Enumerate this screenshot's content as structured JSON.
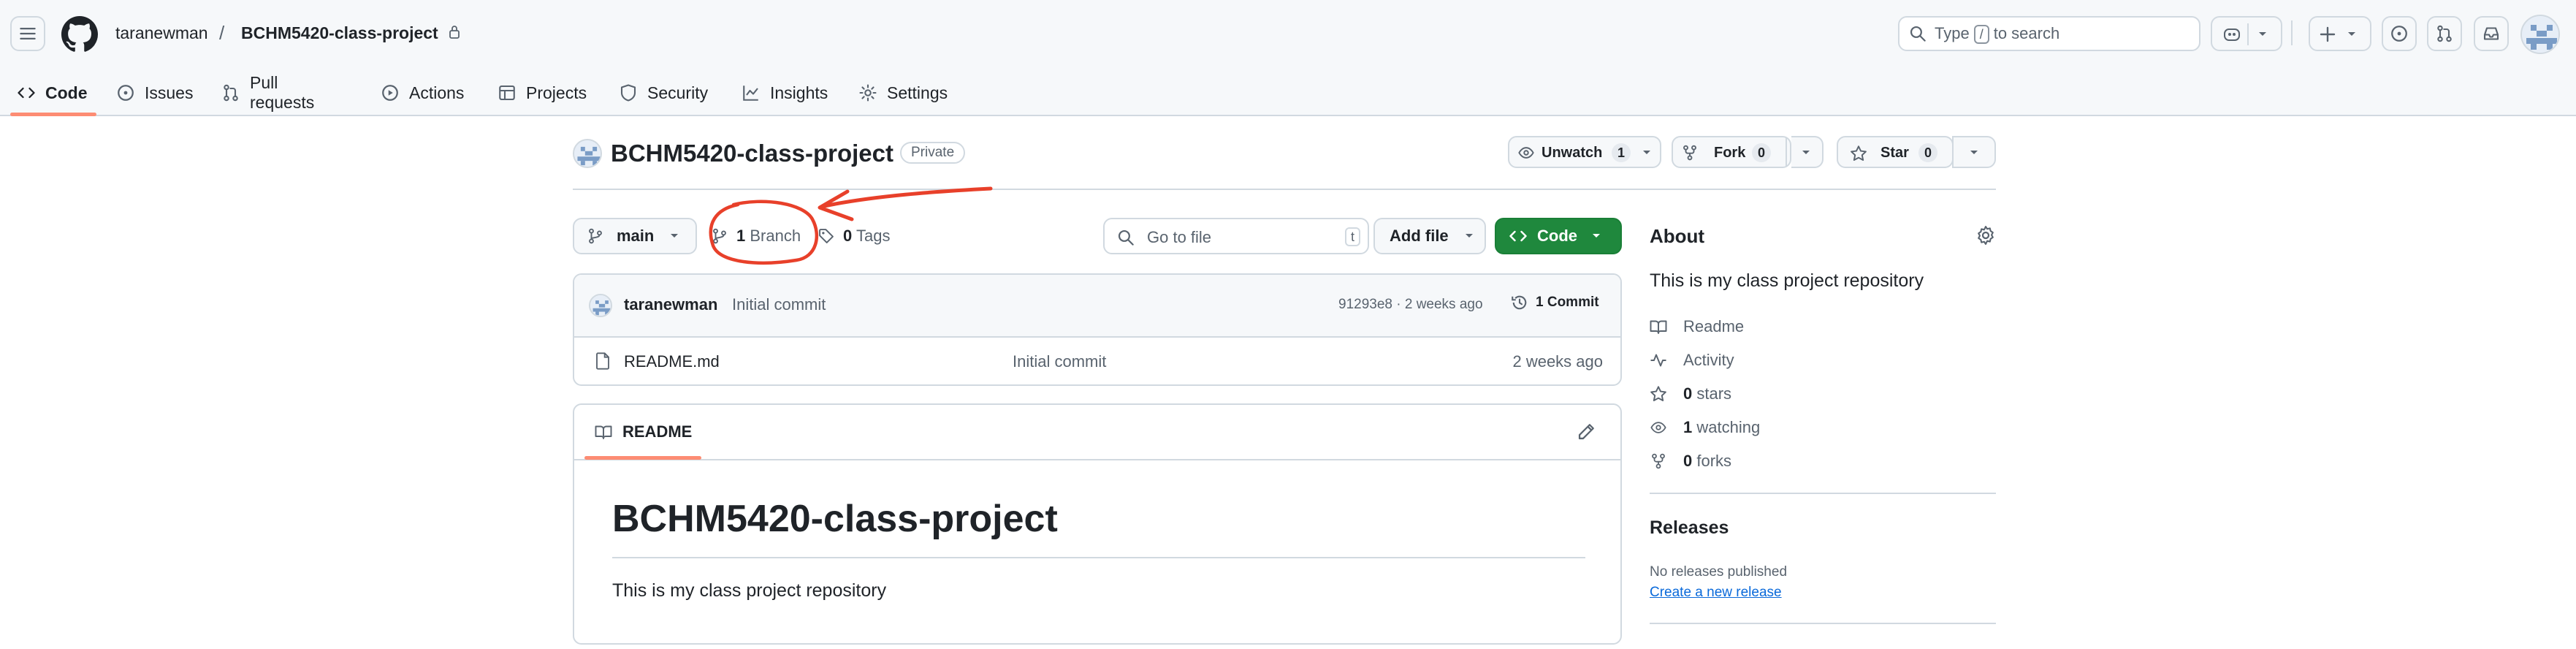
{
  "header": {
    "owner": "taranewman",
    "separator": "/",
    "repo": "BCHM5420-class-project",
    "search_prefix": "Type",
    "search_key": "/",
    "search_suffix": "to search"
  },
  "tabs": [
    {
      "label": "Code",
      "icon": "code-icon"
    },
    {
      "label": "Issues",
      "icon": "issue-icon"
    },
    {
      "label": "Pull requests",
      "icon": "pull-request-icon"
    },
    {
      "label": "Actions",
      "icon": "play-icon"
    },
    {
      "label": "Projects",
      "icon": "table-icon"
    },
    {
      "label": "Security",
      "icon": "shield-icon"
    },
    {
      "label": "Insights",
      "icon": "graph-icon"
    },
    {
      "label": "Settings",
      "icon": "gear-icon"
    }
  ],
  "repo": {
    "name": "BCHM5420-class-project",
    "visibility": "Private",
    "watch_label": "Unwatch",
    "watch_count": "1",
    "fork_label": "Fork",
    "fork_count": "0",
    "star_label": "Star",
    "star_count": "0"
  },
  "file_nav": {
    "branch": "main",
    "branches_count": "1",
    "branches_label": "Branch",
    "tags_count": "0",
    "tags_label": "Tags",
    "goto_placeholder": "Go to file",
    "goto_key": "t",
    "add_file": "Add file",
    "code_button": "Code"
  },
  "latest_commit": {
    "author": "taranewman",
    "message": "Initial commit",
    "sha": "91293e8",
    "sep": "·",
    "time": "2 weeks ago",
    "commits_count": "1",
    "commits_label": "Commit"
  },
  "files": [
    {
      "name": "README.md",
      "message": "Initial commit",
      "time": "2 weeks ago"
    }
  ],
  "readme": {
    "tab": "README",
    "heading": "BCHM5420-class-project",
    "body": "This is my class project repository"
  },
  "about": {
    "title": "About",
    "description": "This is my class project repository",
    "readme": "Readme",
    "activity": "Activity",
    "stars_count": "0",
    "stars_label": "stars",
    "watching_count": "1",
    "watching_label": "watching",
    "forks_count": "0",
    "forks_label": "forks"
  },
  "releases": {
    "title": "Releases",
    "none": "No releases published",
    "create": "Create a new release"
  },
  "colors": {
    "accent_underline": "#fd8c73",
    "primary_green": "#1f883d",
    "annotation_red": "#e8402a",
    "link_blue": "#0969da"
  }
}
